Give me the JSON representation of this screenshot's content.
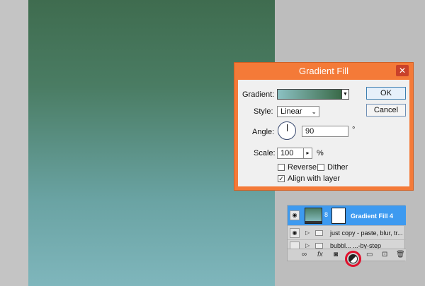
{
  "dialog": {
    "title": "Gradient Fill",
    "close_label": "✕",
    "gradient_label": "Gradient:",
    "style_label": "Style:",
    "style_value": "Linear",
    "angle_label": "Angle:",
    "angle_value": "90",
    "angle_unit": "°",
    "scale_label": "Scale:",
    "scale_value": "100",
    "scale_unit": "%",
    "reverse_label": "Reverse",
    "reverse_checked": false,
    "dither_label": "Dither",
    "dither_checked": false,
    "align_label": "Align with layer",
    "align_checked": true,
    "ok_label": "OK",
    "cancel_label": "Cancel",
    "gradient_colors": [
      "#8cc1c3",
      "#3a6a48"
    ]
  },
  "layers": {
    "rows": [
      {
        "name": "Gradient Fill 4",
        "selected": true
      },
      {
        "name": "just copy - paste, blur, tr..."
      },
      {
        "name": "bubbl... ...-by-step"
      }
    ],
    "toolbar": [
      "link-icon",
      "fx-icon",
      "mask-icon",
      "adjustment-layer-icon",
      "group-icon",
      "new-layer-icon",
      "trash-icon"
    ],
    "fx_label": "fx"
  },
  "canvas": {
    "gradient_top": "#3f6c4f",
    "gradient_bottom": "#7fb6bc"
  }
}
